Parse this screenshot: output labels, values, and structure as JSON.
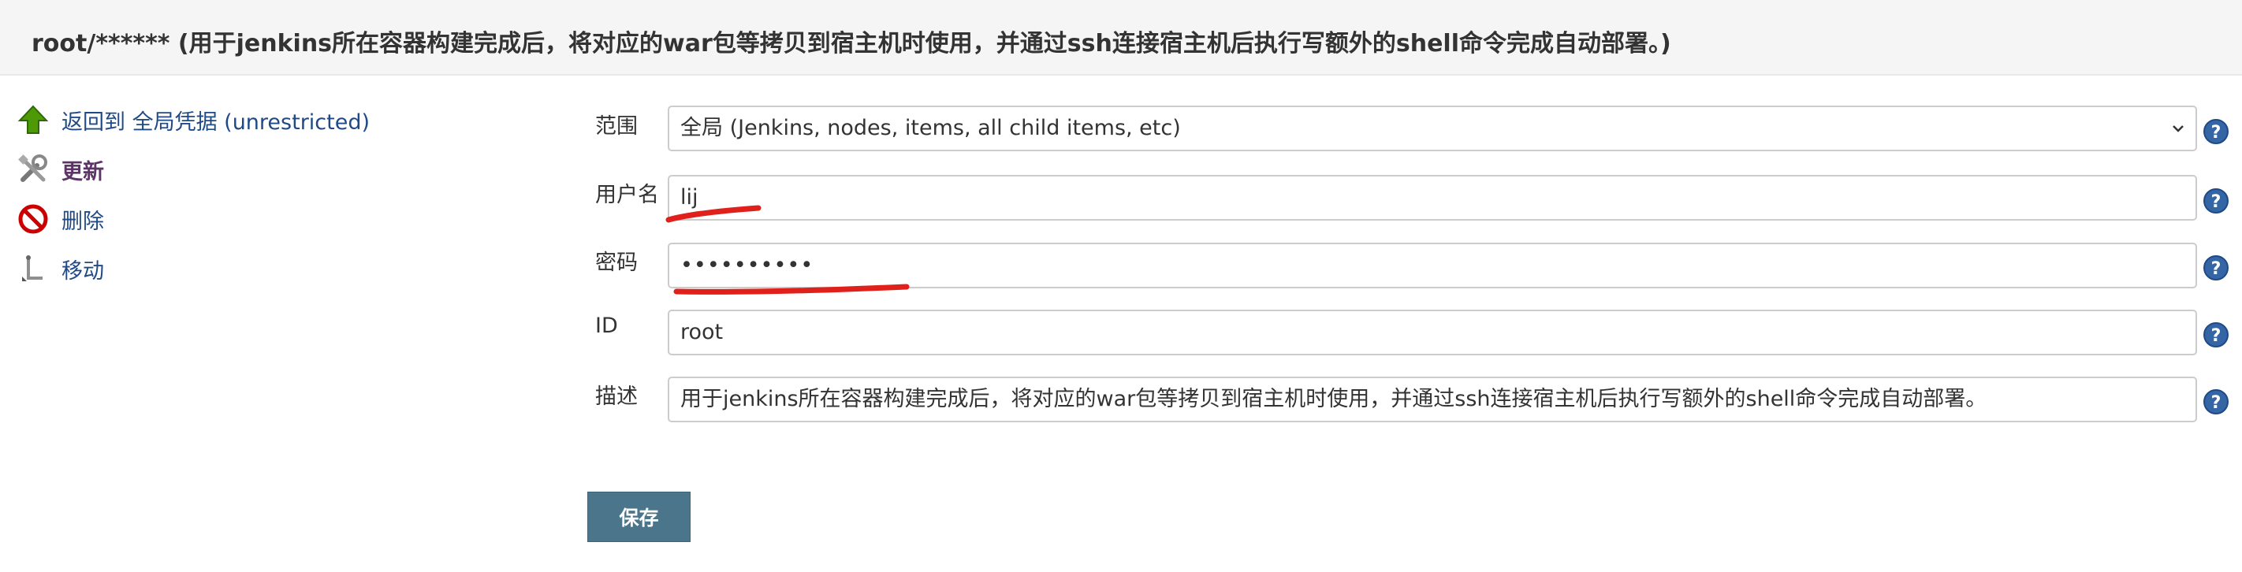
{
  "header": {
    "title": "root/****** (用于jenkins所在容器构建完成后，将对应的war包等拷贝到宿主机时使用，并通过ssh连接宿主机后执行写额外的shell命令完成自动部署。)"
  },
  "sidebar": {
    "items": [
      {
        "label": "返回到 全局凭据 (unrestricted)",
        "icon": "up-arrow-icon"
      },
      {
        "label": "更新",
        "icon": "tools-icon"
      },
      {
        "label": "删除",
        "icon": "no-entry-icon"
      },
      {
        "label": "移动",
        "icon": "move-icon"
      }
    ]
  },
  "form": {
    "scope": {
      "label": "范围",
      "value": "全局 (Jenkins, nodes, items, all child items, etc)"
    },
    "username": {
      "label": "用户名",
      "value": "lij"
    },
    "password": {
      "label": "密码",
      "value": "••••••••••"
    },
    "id": {
      "label": "ID",
      "value": "root"
    },
    "description": {
      "label": "描述",
      "value": "用于jenkins所在容器构建完成后，将对应的war包等拷贝到宿主机时使用，并通过ssh连接宿主机后执行写额外的shell命令完成自动部署。"
    },
    "save_label": "保存"
  },
  "colors": {
    "link": "#204a87",
    "active_link": "#5c3566",
    "save_button": "#4b758b",
    "help_icon": "#3465a4",
    "scribble": "#e0201b"
  }
}
